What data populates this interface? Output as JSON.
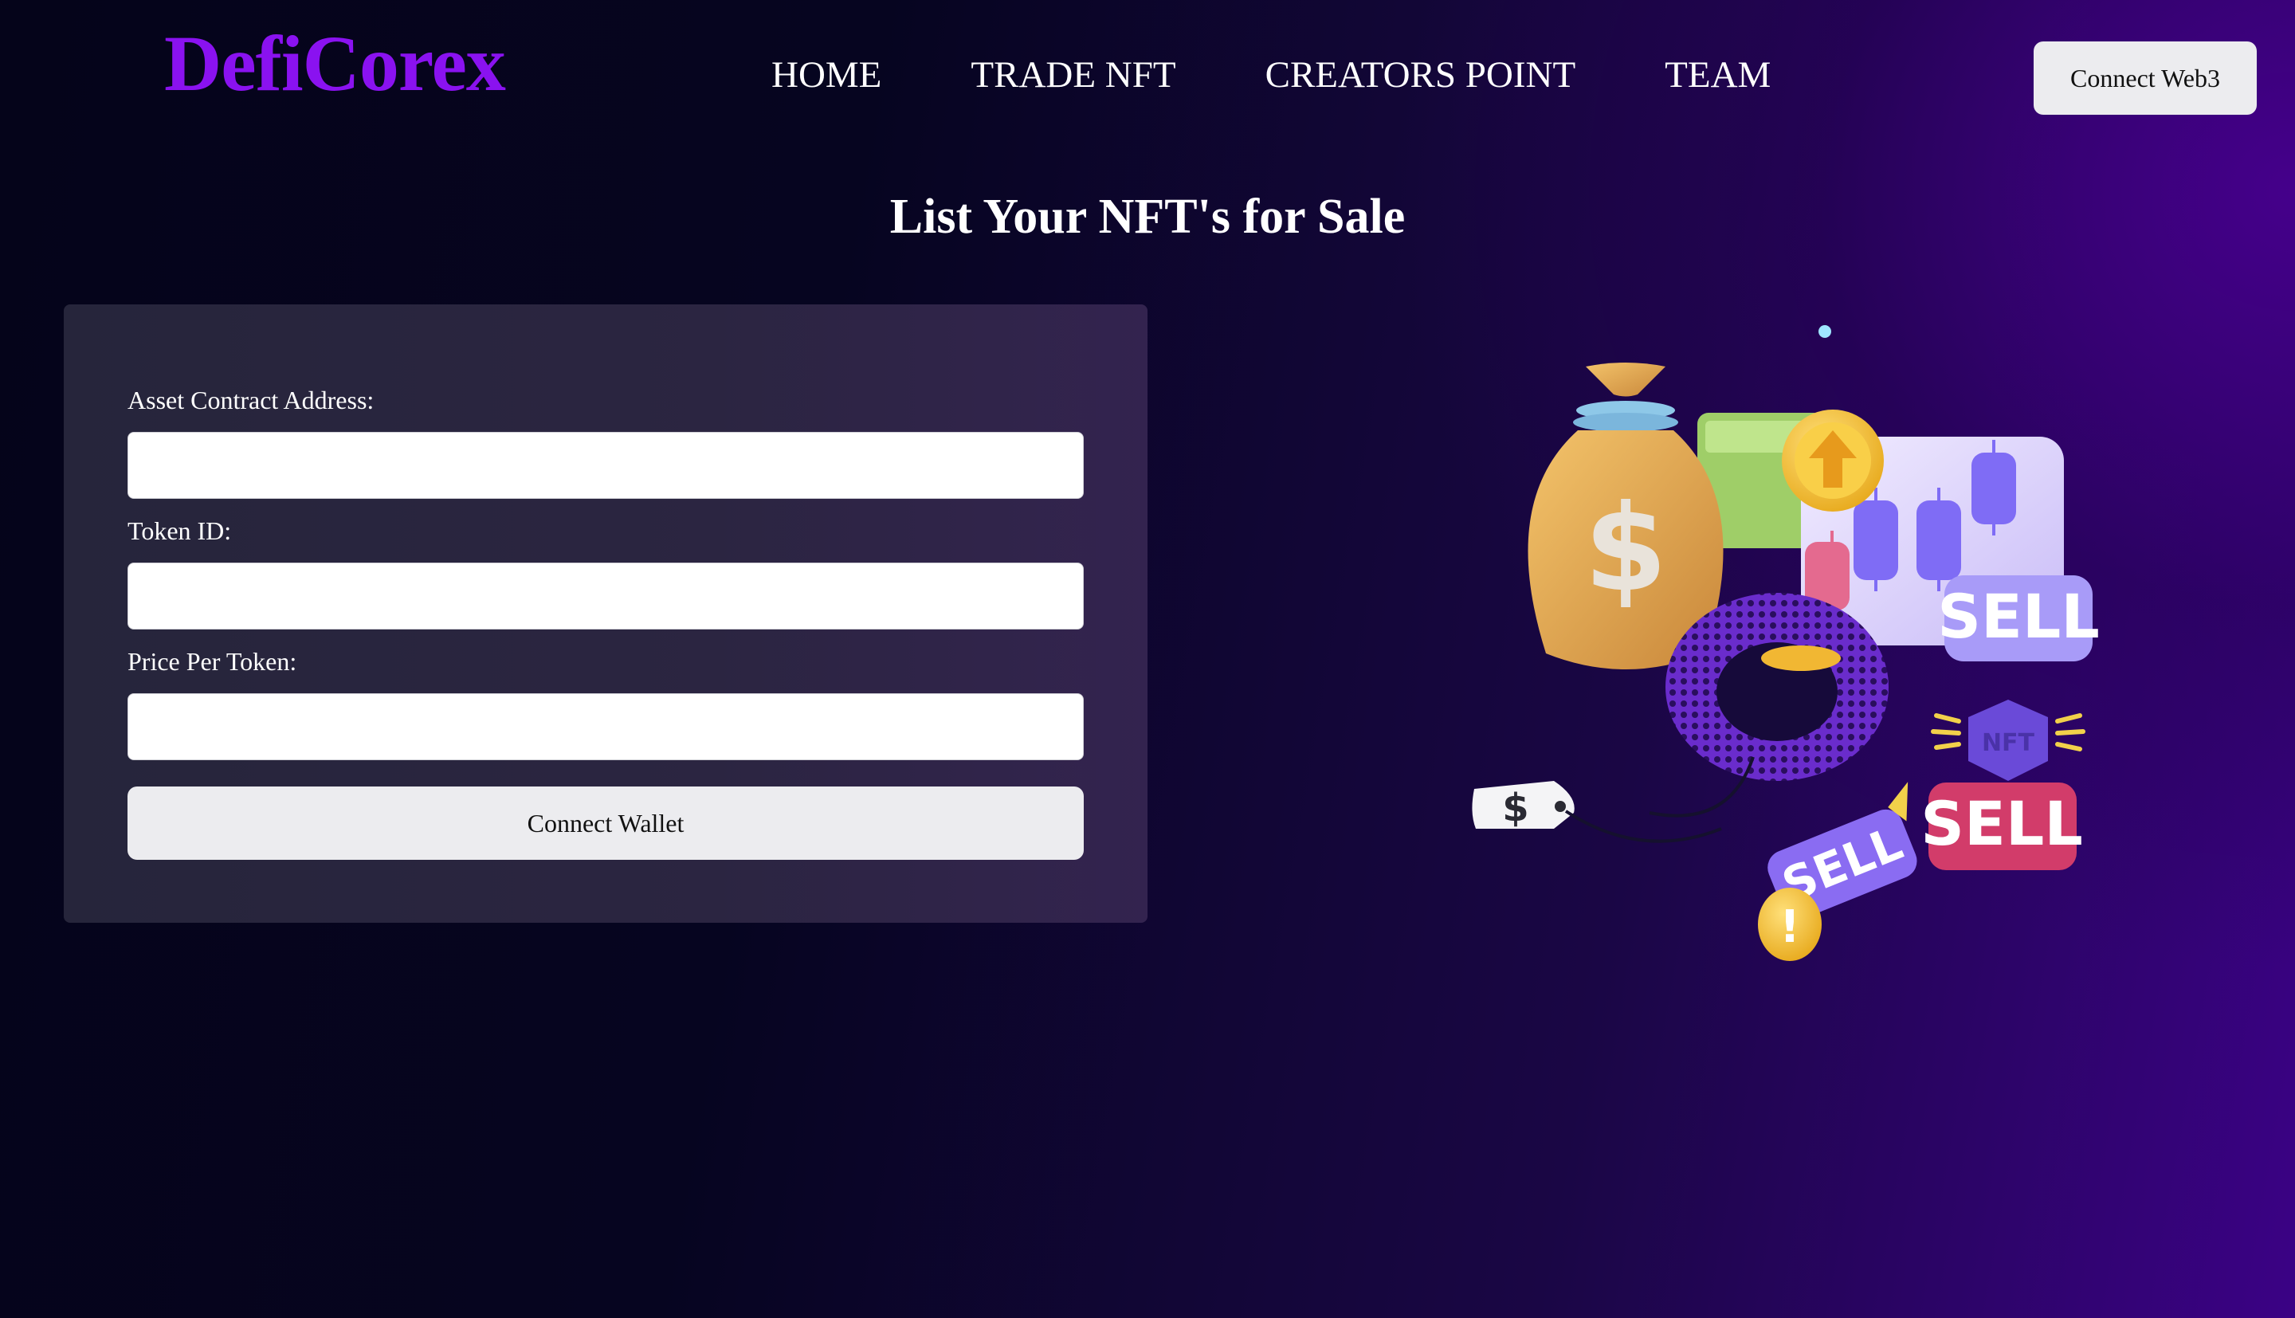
{
  "header": {
    "logo": "DefiCorex",
    "nav": [
      {
        "label": "HOME"
      },
      {
        "label": "TRADE NFT"
      },
      {
        "label": "CREATORS POINT"
      },
      {
        "label": "TEAM"
      }
    ],
    "connect_button": "Connect Web3"
  },
  "main": {
    "title": "List Your NFT's for Sale",
    "form": {
      "fields": [
        {
          "label": "Asset Contract Address:",
          "value": "",
          "placeholder": ""
        },
        {
          "label": "Token ID:",
          "value": "",
          "placeholder": ""
        },
        {
          "label": "Price Per Token:",
          "value": "",
          "placeholder": ""
        }
      ],
      "submit_label": "Connect Wallet"
    }
  },
  "illustration": {
    "icons": [
      "money-bag-icon",
      "chart-card-icon",
      "arrow-up-coin-icon",
      "mesh-ring-icon",
      "nft-hexagon-icon",
      "price-tag-icon",
      "exclamation-coin-icon"
    ],
    "dollar_glyph": "$",
    "sell_label": "SELL",
    "nft_label": "NFT",
    "alert_glyph": "!",
    "colors": {
      "bag": "#e0a64a",
      "card": "#e6defc",
      "candle": "#7f6cf5",
      "candle_red": "#e46a8f",
      "coin": "#f4c232",
      "ring": "#7a35d8",
      "sell_badge": "#a89bf8",
      "sell_badge_red": "#d23c6a"
    }
  },
  "colors": {
    "logo": "#8a12f0",
    "button_bg": "#ececef",
    "card_bg": "#2a2640",
    "bg_dark": "#05041a",
    "bg_accent": "#3b0285"
  }
}
